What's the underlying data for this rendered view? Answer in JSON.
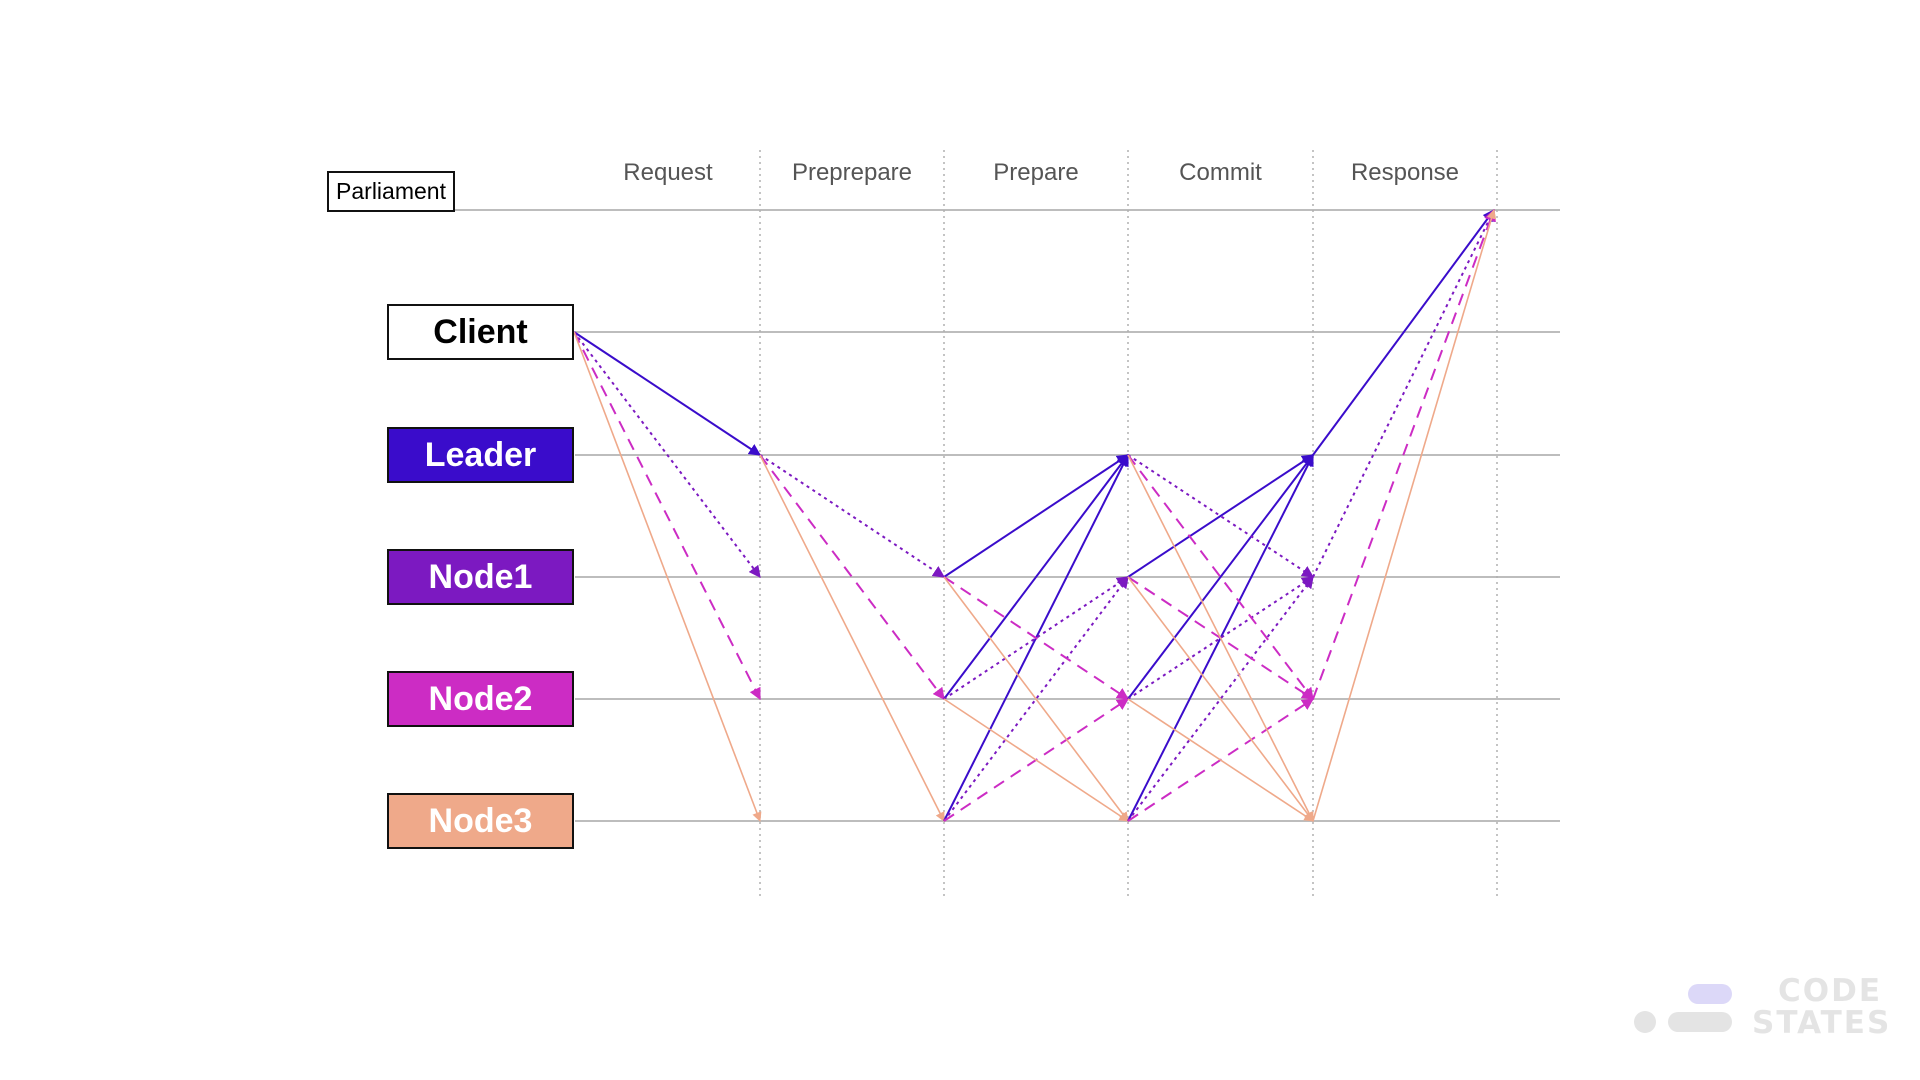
{
  "diagram": {
    "parliament_label": "Parliament",
    "phases": [
      "Request",
      "Preprepare",
      "Prepare",
      "Commit",
      "Response"
    ],
    "participants": [
      {
        "id": "client",
        "label": "Client",
        "fill": "#ffffff",
        "text_color": "#000000"
      },
      {
        "id": "leader",
        "label": "Leader",
        "fill": "#3a0ccb",
        "text_color": "#ffffff"
      },
      {
        "id": "node1",
        "label": "Node1",
        "fill": "#7c19c1",
        "text_color": "#ffffff"
      },
      {
        "id": "node2",
        "label": "Node2",
        "fill": "#cc2cc4",
        "text_color": "#ffffff"
      },
      {
        "id": "node3",
        "label": "Node3",
        "fill": "#efa98a",
        "text_color": "#ffffff"
      }
    ],
    "line_styles": {
      "leader": {
        "color": "#3a0ccb",
        "dash": "solid"
      },
      "node1": {
        "color": "#7c19c1",
        "dash": "dotted"
      },
      "node2": {
        "color": "#cc2cc4",
        "dash": "dashed"
      },
      "node3": {
        "color": "#efa98a",
        "dash": "solid"
      }
    },
    "messages": [
      {
        "phase": "Request",
        "from": "client",
        "to": "leader",
        "style": "leader"
      },
      {
        "phase": "Request",
        "from": "client",
        "to": "node1",
        "style": "node1"
      },
      {
        "phase": "Request",
        "from": "client",
        "to": "node2",
        "style": "node2"
      },
      {
        "phase": "Request",
        "from": "client",
        "to": "node3",
        "style": "node3"
      },
      {
        "phase": "Preprepare",
        "from": "leader",
        "to": "node1",
        "style": "node1"
      },
      {
        "phase": "Preprepare",
        "from": "leader",
        "to": "node2",
        "style": "node2"
      },
      {
        "phase": "Preprepare",
        "from": "leader",
        "to": "node3",
        "style": "node3"
      },
      {
        "phase": "Prepare",
        "from": "node1",
        "to": "leader",
        "style": "leader"
      },
      {
        "phase": "Prepare",
        "from": "node2",
        "to": "leader",
        "style": "leader"
      },
      {
        "phase": "Prepare",
        "from": "node3",
        "to": "leader",
        "style": "leader"
      },
      {
        "phase": "Prepare",
        "from": "node2",
        "to": "node1",
        "style": "node1"
      },
      {
        "phase": "Prepare",
        "from": "node3",
        "to": "node1",
        "style": "node1"
      },
      {
        "phase": "Prepare",
        "from": "node1",
        "to": "node2",
        "style": "node2"
      },
      {
        "phase": "Prepare",
        "from": "node3",
        "to": "node2",
        "style": "node2"
      },
      {
        "phase": "Prepare",
        "from": "node1",
        "to": "node3",
        "style": "node3"
      },
      {
        "phase": "Prepare",
        "from": "node2",
        "to": "node3",
        "style": "node3"
      },
      {
        "phase": "Commit",
        "from": "node1",
        "to": "leader",
        "style": "leader"
      },
      {
        "phase": "Commit",
        "from": "node2",
        "to": "leader",
        "style": "leader"
      },
      {
        "phase": "Commit",
        "from": "node3",
        "to": "leader",
        "style": "leader"
      },
      {
        "phase": "Commit",
        "from": "leader",
        "to": "node1",
        "style": "node1"
      },
      {
        "phase": "Commit",
        "from": "node2",
        "to": "node1",
        "style": "node1"
      },
      {
        "phase": "Commit",
        "from": "node3",
        "to": "node1",
        "style": "node1"
      },
      {
        "phase": "Commit",
        "from": "leader",
        "to": "node2",
        "style": "node2"
      },
      {
        "phase": "Commit",
        "from": "node1",
        "to": "node2",
        "style": "node2"
      },
      {
        "phase": "Commit",
        "from": "node3",
        "to": "node2",
        "style": "node2"
      },
      {
        "phase": "Commit",
        "from": "leader",
        "to": "node3",
        "style": "node3"
      },
      {
        "phase": "Commit",
        "from": "node1",
        "to": "node3",
        "style": "node3"
      },
      {
        "phase": "Commit",
        "from": "node2",
        "to": "node3",
        "style": "node3"
      },
      {
        "phase": "Response",
        "from": "leader",
        "to": "parliament",
        "style": "leader"
      },
      {
        "phase": "Response",
        "from": "node1",
        "to": "parliament",
        "style": "node1"
      },
      {
        "phase": "Response",
        "from": "node2",
        "to": "parliament",
        "style": "node2"
      },
      {
        "phase": "Response",
        "from": "node3",
        "to": "parliament",
        "style": "node3"
      }
    ]
  },
  "logo": {
    "line1": "CODE",
    "line2": "STATES",
    "accent_color": "#dcd8f8",
    "gray_color": "#e4e4e4",
    "icon_name": "codestates-logo-icon"
  }
}
